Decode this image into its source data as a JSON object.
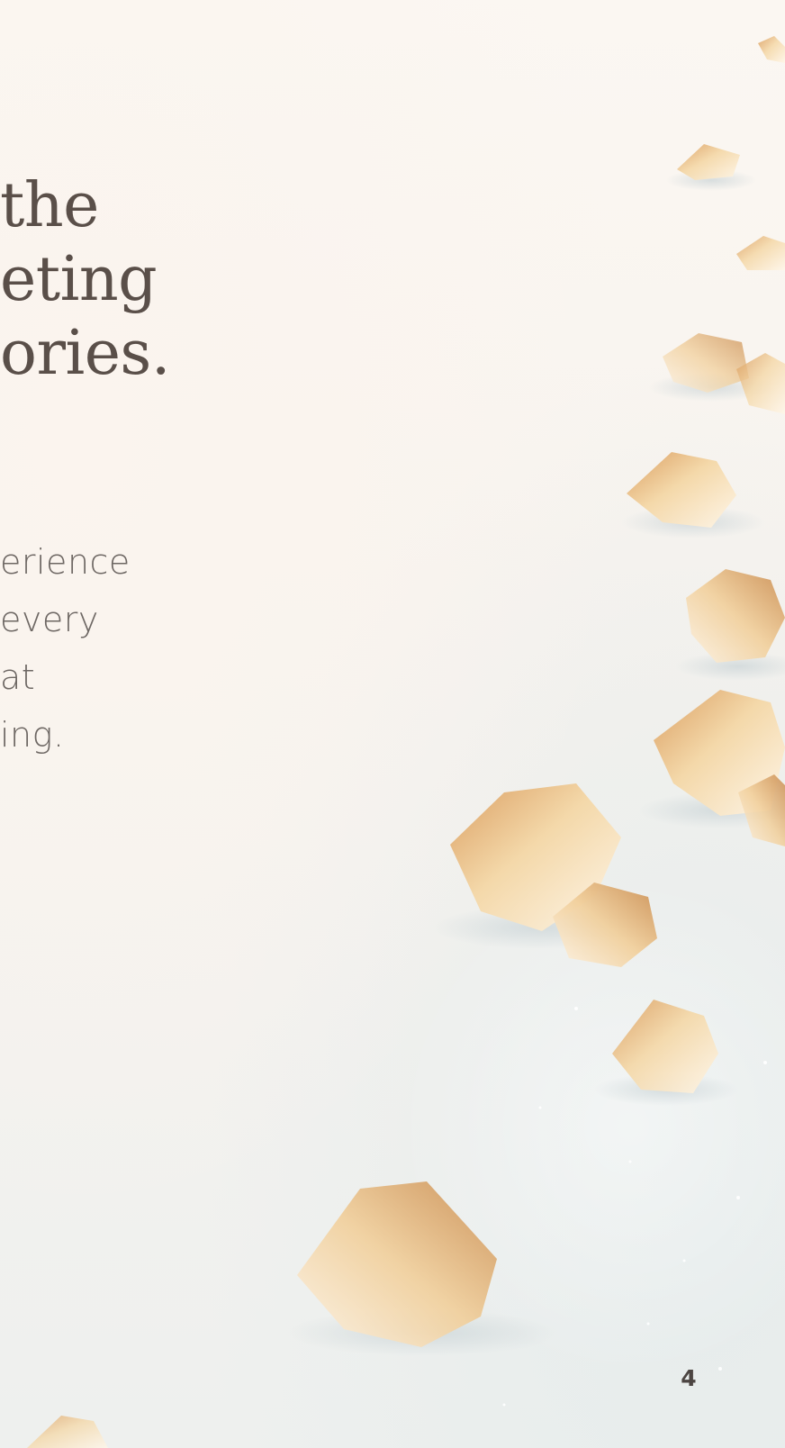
{
  "headline": {
    "lines": [
      "the",
      "eting",
      "ories."
    ]
  },
  "body": {
    "lines": [
      "erience",
      "every",
      "at",
      "ing."
    ]
  },
  "page_number": "4"
}
